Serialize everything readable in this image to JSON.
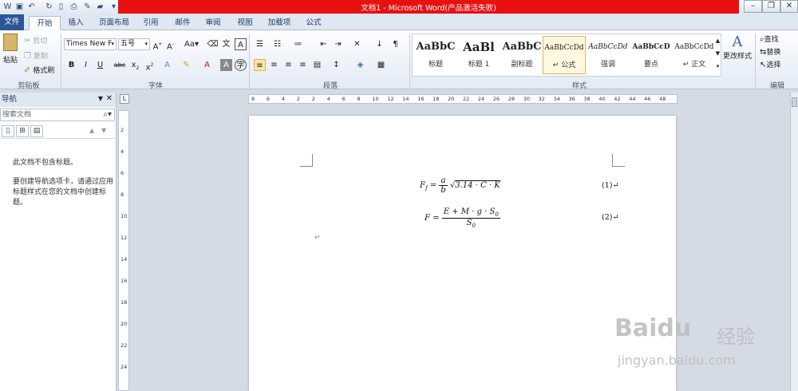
{
  "titlebar": {
    "title": "文档1 - Microsoft Word(产品激活失败)",
    "qat_icons": [
      "save-icon",
      "undo-icon",
      "redo-icon",
      "new-doc-icon",
      "print-preview-icon",
      "spellcheck-icon",
      "open-icon",
      "customize-qat-icon"
    ],
    "title_bar_color": "#e81010"
  },
  "tabs": {
    "file": "文件",
    "items": [
      "开始",
      "插入",
      "页面布局",
      "引用",
      "邮件",
      "审阅",
      "视图",
      "加载项",
      "公式"
    ],
    "active": "开始"
  },
  "ribbon": {
    "clipboard": {
      "label": "剪贴板",
      "paste": "粘贴",
      "cut": "剪切",
      "copy": "复制",
      "format_painter": "格式刷"
    },
    "font": {
      "label": "字体",
      "font_name": "Times New F",
      "font_size": "五号"
    },
    "paragraph": {
      "label": "段落"
    },
    "styles": {
      "label": "样式",
      "items": [
        {
          "sample": "AaBbC",
          "name": "标题"
        },
        {
          "sample": "AaBl",
          "name": "标题 1"
        },
        {
          "sample": "AaBbC",
          "name": "副标题"
        },
        {
          "sample": "AaBbCcDd",
          "name": "↵ 公式"
        },
        {
          "sample": "AaBbCcDd",
          "name": "强调"
        },
        {
          "sample": "AaBbCcD",
          "name": "要点"
        },
        {
          "sample": "AaBbCcDd",
          "name": "↵ 正文"
        }
      ],
      "change_styles": "更改样式"
    },
    "editing": {
      "label": "编辑",
      "find": "查找",
      "replace": "替换",
      "select": "选择"
    }
  },
  "nav": {
    "title": "导航",
    "search_placeholder": "搜索文档",
    "no_headings": "此文档不包含标题。",
    "hint": "要创建导航选项卡，请通过应用标题样式在您的文档中创建标题。"
  },
  "ruler": {
    "horizontal": [
      "8",
      "6",
      "4",
      "2",
      "2",
      "4",
      "6",
      "8",
      "10",
      "12",
      "14",
      "16",
      "18",
      "20",
      "22",
      "24",
      "26",
      "28",
      "30",
      "32",
      "34",
      "36",
      "38",
      "40",
      "42",
      "44",
      "46",
      "48"
    ],
    "vertical": [
      "2",
      "4",
      "6",
      "8",
      "10",
      "12",
      "14",
      "16",
      "18",
      "20",
      "22",
      "24"
    ]
  },
  "document": {
    "equations": [
      {
        "lhs": "F",
        "lhs_sub": "f",
        "num": "a",
        "den": "b",
        "radicand": "3.14 · C · K",
        "number": "(1)↵"
      },
      {
        "lhs": "F",
        "num": "E + M · g · S",
        "num_sub": "0",
        "den": "S",
        "den_sub": "0",
        "number": "(2)↵"
      }
    ],
    "paragraph_mark": "↵"
  },
  "watermark": {
    "brand": "Baidu",
    "cn": "经验",
    "url": "jingyan.baidu.com"
  }
}
